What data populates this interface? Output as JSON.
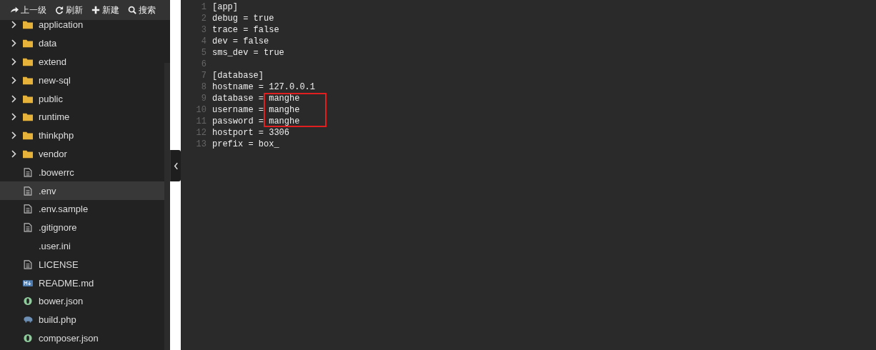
{
  "toolbar": [
    {
      "label": "上一级"
    },
    {
      "label": "刷新"
    },
    {
      "label": "新建"
    },
    {
      "label": "搜索"
    }
  ],
  "files": [
    {
      "name": "application",
      "kind": "folder",
      "selected": false
    },
    {
      "name": "data",
      "kind": "folder",
      "selected": false
    },
    {
      "name": "extend",
      "kind": "folder",
      "selected": false
    },
    {
      "name": "new-sql",
      "kind": "folder",
      "selected": false
    },
    {
      "name": "public",
      "kind": "folder",
      "selected": false
    },
    {
      "name": "runtime",
      "kind": "folder",
      "selected": false
    },
    {
      "name": "thinkphp",
      "kind": "folder",
      "selected": false
    },
    {
      "name": "vendor",
      "kind": "folder",
      "selected": false
    },
    {
      "name": ".bowerrc",
      "kind": "text",
      "selected": false
    },
    {
      "name": ".env",
      "kind": "text",
      "selected": true
    },
    {
      "name": ".env.sample",
      "kind": "text",
      "selected": false
    },
    {
      "name": ".gitignore",
      "kind": "text",
      "selected": false
    },
    {
      "name": ".user.ini",
      "kind": "plain",
      "selected": false
    },
    {
      "name": "LICENSE",
      "kind": "text",
      "selected": false
    },
    {
      "name": "README.md",
      "kind": "markdown",
      "selected": false
    },
    {
      "name": "bower.json",
      "kind": "json",
      "selected": false
    },
    {
      "name": "build.php",
      "kind": "php",
      "selected": false
    },
    {
      "name": "composer.json",
      "kind": "json",
      "selected": false
    }
  ],
  "editor": {
    "lines": [
      {
        "number": "1",
        "text": "[app]",
        "highlighted": false
      },
      {
        "number": "2",
        "text": "debug = true",
        "highlighted": false
      },
      {
        "number": "3",
        "text": "trace = false",
        "highlighted": false
      },
      {
        "number": "4",
        "text": "dev = false",
        "highlighted": false
      },
      {
        "number": "5",
        "text": "sms_dev = true",
        "highlighted": false
      },
      {
        "number": "6",
        "highlighted": false
      },
      {
        "number": "7",
        "text": "[database]",
        "highlighted": false
      },
      {
        "number": "8",
        "text": "hostname = 127.0.0.1",
        "highlighted": false
      },
      {
        "number": "9",
        "text": "database = manghe",
        "highlighted": true
      },
      {
        "number": "10",
        "text": "username = manghe",
        "highlighted": true
      },
      {
        "number": "11",
        "text": "password = manghe",
        "highlighted": true
      },
      {
        "number": "12",
        "text": "hostport = 3306",
        "highlighted": false
      },
      {
        "number": "13",
        "text": "prefix = box_",
        "highlighted": false
      }
    ]
  }
}
